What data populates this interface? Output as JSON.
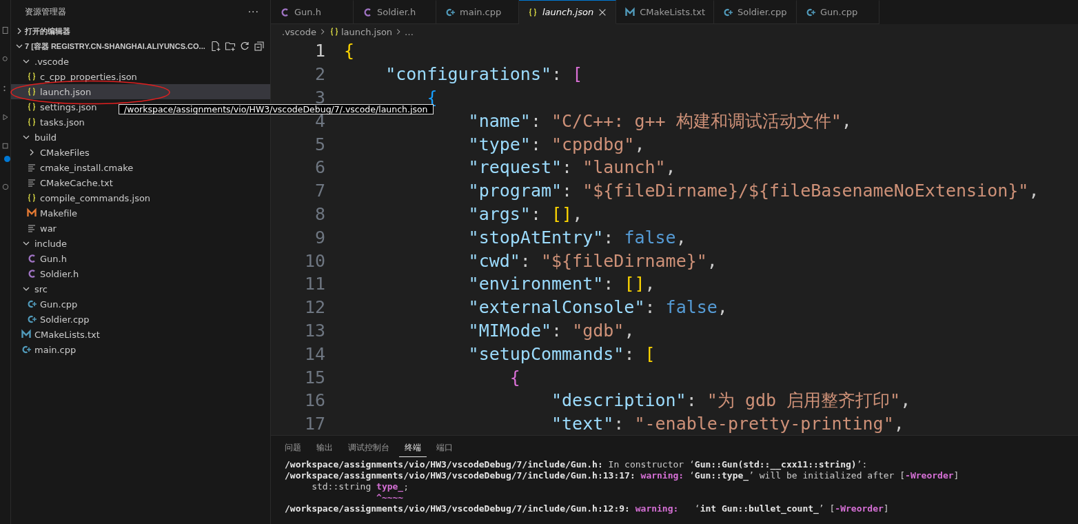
{
  "activity_bar": {
    "badge": true
  },
  "explorer": {
    "title": "资源管理器",
    "more": "···",
    "open_editors": {
      "label": "打开的编辑器",
      "expanded": false
    },
    "folder": {
      "label": "7 [容器 REGISTRY.CN-SHANGHAI.ALIYUNCS.CO...",
      "expanded": true,
      "children": [
        {
          "name": ".vscode",
          "kind": "folder",
          "expanded": true,
          "selected": false,
          "children": [
            {
              "name": "c_cpp_properties.json",
              "kind": "json",
              "selected": false
            },
            {
              "name": "launch.json",
              "kind": "json",
              "selected": true
            },
            {
              "name": "settings.json",
              "kind": "json",
              "selected": false
            },
            {
              "name": "tasks.json",
              "kind": "json",
              "selected": false
            }
          ]
        },
        {
          "name": "build",
          "kind": "folder",
          "expanded": true,
          "selected": false,
          "children": [
            {
              "name": "CMakeFiles",
              "kind": "folder",
              "expanded": false,
              "selected": false
            },
            {
              "name": "cmake_install.cmake",
              "kind": "text",
              "selected": false
            },
            {
              "name": "CMakeCache.txt",
              "kind": "text",
              "selected": false
            },
            {
              "name": "compile_commands.json",
              "kind": "json",
              "selected": false
            },
            {
              "name": "Makefile",
              "kind": "make",
              "selected": false
            },
            {
              "name": "war",
              "kind": "text",
              "selected": false
            }
          ]
        },
        {
          "name": "include",
          "kind": "folder",
          "expanded": true,
          "selected": false,
          "children": [
            {
              "name": "Gun.h",
              "kind": "c",
              "selected": false
            },
            {
              "name": "Soldier.h",
              "kind": "c",
              "selected": false
            }
          ]
        },
        {
          "name": "src",
          "kind": "folder",
          "expanded": true,
          "selected": false,
          "children": [
            {
              "name": "Gun.cpp",
              "kind": "cpp",
              "selected": false
            },
            {
              "name": "Soldier.cpp",
              "kind": "cpp",
              "selected": false
            }
          ]
        },
        {
          "name": "CMakeLists.txt",
          "kind": "cmake",
          "selected": false
        },
        {
          "name": "main.cpp",
          "kind": "cpp",
          "selected": false
        }
      ]
    }
  },
  "tooltip": "/workspace/assignments/vio/HW3/vscodeDebug/7/.vscode/launch.json",
  "tabs": [
    {
      "label": "Gun.h",
      "kind": "c",
      "selected": false
    },
    {
      "label": "Soldier.h",
      "kind": "c",
      "selected": false
    },
    {
      "label": "main.cpp",
      "kind": "cpp",
      "selected": false
    },
    {
      "label": "launch.json",
      "kind": "json",
      "selected": true
    },
    {
      "label": "CMakeLists.txt",
      "kind": "cmake",
      "selected": false
    },
    {
      "label": "Soldier.cpp",
      "kind": "cpp",
      "selected": false
    },
    {
      "label": "Gun.cpp",
      "kind": "cpp",
      "selected": false
    }
  ],
  "breadcrumb": [
    {
      "label": ".vscode",
      "kind": "folder"
    },
    {
      "label": "launch.json",
      "kind": "json"
    },
    {
      "label": "…",
      "kind": "more"
    }
  ],
  "code": [
    {
      "number": "1",
      "tokens": [
        {
          "kind": "bracket",
          "text": "{",
          "color": "#ffd700"
        }
      ]
    },
    {
      "number": "2",
      "tokens": [
        {
          "kind": "key",
          "text": "\"configurations\""
        },
        {
          "kind": "plain",
          "text": ": "
        },
        {
          "kind": "bracket",
          "text": "[",
          "color": "#da70d6"
        }
      ]
    },
    {
      "number": "3",
      "tokens": [
        {
          "kind": "bracket",
          "text": "{",
          "color": "#179fff"
        }
      ]
    },
    {
      "number": "4",
      "tokens": [
        {
          "kind": "key",
          "text": "\"name\""
        },
        {
          "kind": "plain",
          "text": ": "
        },
        {
          "kind": "string",
          "text": "\"C/C++: g++ 构建和调试活动文件\""
        },
        {
          "kind": "plain",
          "text": ","
        }
      ]
    },
    {
      "number": "5",
      "tokens": [
        {
          "kind": "key",
          "text": "\"type\""
        },
        {
          "kind": "plain",
          "text": ": "
        },
        {
          "kind": "string",
          "text": "\"cppdbg\""
        },
        {
          "kind": "plain",
          "text": ","
        }
      ]
    },
    {
      "number": "6",
      "tokens": [
        {
          "kind": "key",
          "text": "\"request\""
        },
        {
          "kind": "plain",
          "text": ": "
        },
        {
          "kind": "string",
          "text": "\"launch\""
        },
        {
          "kind": "plain",
          "text": ","
        }
      ]
    },
    {
      "number": "7",
      "tokens": [
        {
          "kind": "key",
          "text": "\"program\""
        },
        {
          "kind": "plain",
          "text": ": "
        },
        {
          "kind": "string",
          "text": "\"${fileDirname}/${fileBasenameNoExtension}\""
        },
        {
          "kind": "plain",
          "text": ","
        }
      ]
    },
    {
      "number": "8",
      "tokens": [
        {
          "kind": "key",
          "text": "\"args\""
        },
        {
          "kind": "plain",
          "text": ": "
        },
        {
          "kind": "bracket",
          "text": "[]",
          "color": "#ffd700"
        },
        {
          "kind": "plain",
          "text": ","
        }
      ]
    },
    {
      "number": "9",
      "tokens": [
        {
          "kind": "key",
          "text": "\"stopAtEntry\""
        },
        {
          "kind": "plain",
          "text": ": "
        },
        {
          "kind": "bool",
          "text": "false"
        },
        {
          "kind": "plain",
          "text": ","
        }
      ]
    },
    {
      "number": "10",
      "tokens": [
        {
          "kind": "key",
          "text": "\"cwd\""
        },
        {
          "kind": "plain",
          "text": ": "
        },
        {
          "kind": "string",
          "text": "\"${fileDirname}\""
        },
        {
          "kind": "plain",
          "text": ","
        }
      ]
    },
    {
      "number": "11",
      "tokens": [
        {
          "kind": "key",
          "text": "\"environment\""
        },
        {
          "kind": "plain",
          "text": ": "
        },
        {
          "kind": "bracket",
          "text": "[]",
          "color": "#ffd700"
        },
        {
          "kind": "plain",
          "text": ","
        }
      ]
    },
    {
      "number": "12",
      "tokens": [
        {
          "kind": "key",
          "text": "\"externalConsole\""
        },
        {
          "kind": "plain",
          "text": ": "
        },
        {
          "kind": "bool",
          "text": "false"
        },
        {
          "kind": "plain",
          "text": ","
        }
      ]
    },
    {
      "number": "13",
      "tokens": [
        {
          "kind": "key",
          "text": "\"MIMode\""
        },
        {
          "kind": "plain",
          "text": ": "
        },
        {
          "kind": "string",
          "text": "\"gdb\""
        },
        {
          "kind": "plain",
          "text": ","
        }
      ]
    },
    {
      "number": "14",
      "tokens": [
        {
          "kind": "key",
          "text": "\"setupCommands\""
        },
        {
          "kind": "plain",
          "text": ": "
        },
        {
          "kind": "bracket",
          "text": "[",
          "color": "#ffd700"
        }
      ]
    },
    {
      "number": "15",
      "tokens": [
        {
          "kind": "bracket",
          "text": "{",
          "color": "#da70d6"
        }
      ]
    },
    {
      "number": "16",
      "tokens": [
        {
          "kind": "key",
          "text": "\"description\""
        },
        {
          "kind": "plain",
          "text": ": "
        },
        {
          "kind": "string",
          "text": "\"为 gdb 启用整齐打印\""
        },
        {
          "kind": "plain",
          "text": ","
        }
      ]
    },
    {
      "number": "17",
      "tokens": [
        {
          "kind": "key",
          "text": "\"text\""
        },
        {
          "kind": "plain",
          "text": ": "
        },
        {
          "kind": "string",
          "text": "\"-enable-pretty-printing\""
        },
        {
          "kind": "plain",
          "text": ","
        }
      ]
    }
  ],
  "panel": {
    "tabs": [
      {
        "label": "问题",
        "selected": false
      },
      {
        "label": "输出",
        "selected": false
      },
      {
        "label": "调试控制台",
        "selected": false
      },
      {
        "label": "终端",
        "selected": true
      },
      {
        "label": "端口",
        "selected": false
      }
    ],
    "terminal": [
      [
        {
          "kind": "bold",
          "text": "/workspace/assignments/vio/HW3/vscodeDebug/7/include/Gun.h:"
        },
        {
          "kind": "plain",
          "text": " In constructor ‘"
        },
        {
          "kind": "bold",
          "text": "Gun::Gun(std::__cxx11::string)"
        },
        {
          "kind": "plain",
          "text": "’:"
        }
      ],
      [
        {
          "kind": "bold",
          "text": "/workspace/assignments/vio/HW3/vscodeDebug/7/include/Gun.h:13:17:"
        },
        {
          "kind": "warn",
          "text": " warning:"
        },
        {
          "kind": "plain",
          "text": " ‘"
        },
        {
          "kind": "bold",
          "text": "Gun::type_"
        },
        {
          "kind": "plain",
          "text": "’ will be initialized after ["
        },
        {
          "kind": "warn",
          "text": "-Wreorder"
        },
        {
          "kind": "plain",
          "text": "]"
        }
      ],
      [
        {
          "kind": "plain",
          "text": "     std::string "
        },
        {
          "kind": "warn",
          "text": "type_"
        },
        {
          "kind": "plain",
          "text": ";"
        }
      ],
      [
        {
          "kind": "warn",
          "text": "                 ^~~~~"
        }
      ],
      [
        {
          "kind": "bold",
          "text": "/workspace/assignments/vio/HW3/vscodeDebug/7/include/Gun.h:12:9:"
        },
        {
          "kind": "warn",
          "text": " warning:"
        },
        {
          "kind": "plain",
          "text": "   ‘"
        },
        {
          "kind": "bold",
          "text": "int Gun::bullet_count_"
        },
        {
          "kind": "plain",
          "text": "’ ["
        },
        {
          "kind": "warn",
          "text": "-Wreorder"
        },
        {
          "kind": "plain",
          "text": "]"
        }
      ]
    ]
  }
}
